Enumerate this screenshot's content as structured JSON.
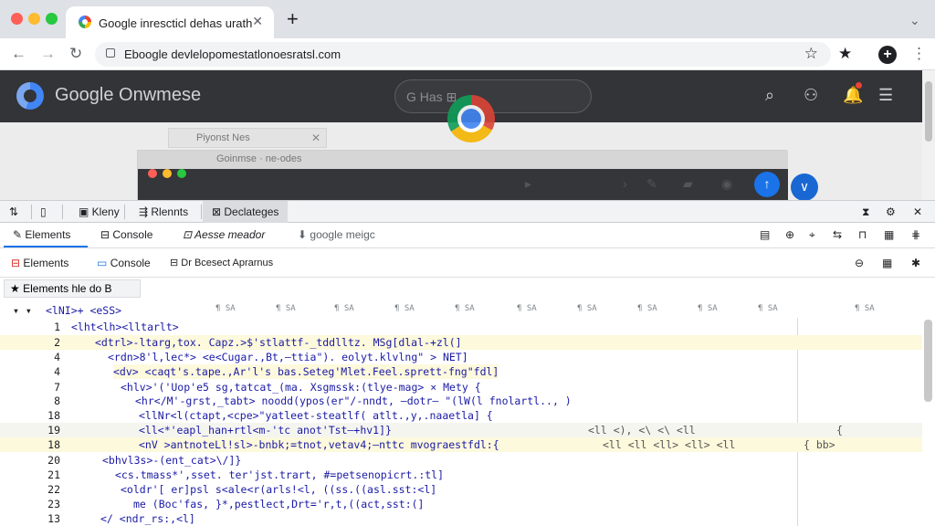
{
  "browser": {
    "tab_title": "Google inrescticl dehas urath",
    "tab_close": "✕",
    "new_tab": "+",
    "url": "Eboogle devlelopomestatlonoesratsl.com",
    "colors": {
      "tabstrip": "#dee1e6",
      "close": "#ff5f57",
      "minimize": "#febc2e",
      "maximize": "#28c840"
    }
  },
  "page": {
    "header_title": "Google Onwmese",
    "search_text": "G Has ⊞",
    "ghost_window_title": "Piyonst  Nes",
    "ghost_bar_title": "Goinmse ·  ne-odes"
  },
  "devtools": {
    "top_tabs": [
      "Kleny",
      "Rlennts",
      "Declateges"
    ],
    "second_tabs": [
      "Elements",
      "Console",
      "Aesse meador",
      "google meigc"
    ],
    "third_tabs": [
      "Elements",
      "Console",
      "Dr Bcesect Aprarnus"
    ],
    "breadcrumb": "Elements hle do  B",
    "column_marker": "¶ SA",
    "lines": [
      {
        "num": "",
        "code": "<lNI>+ <eSS>"
      },
      {
        "num": "1",
        "code": "<lht<lh><lltarlt>"
      },
      {
        "num": "2",
        "code": "<dtrl>-ltarg,tox. Capz.>$'stlattf-_tddlltz. MSg[dlal-+zl(]"
      },
      {
        "num": "4",
        "code": "<rdn>8'l,lec*> <e<Cugar.,Bt,—ttia\"). eolyt.klvlng\" > NET]"
      },
      {
        "num": "4",
        "code": "<dv> <caqt's.tape.,Ar'l's  bas.Seteg'Mlet.Feel.sprett-fng\"fdl]"
      },
      {
        "num": "7",
        "code": "<hlv>'('Uop'e5 sg,tatcat_(ma.  Xsgmssk:(tlye-mag> × Mety  {"
      },
      {
        "num": "8",
        "code": "<hr</M'-grst,_tabt> noodd(ypos(er\"/-nndt, —dotr— \"(lW(l     fnolartl.., )"
      },
      {
        "num": "18",
        "code": "<llNr<l(ctapt,<cpe>\"yatleet-steatlf(  atlt.,y,.naaetla]  {"
      },
      {
        "num": "19",
        "code": "<ll<*'eapl_han+rtl<m-'tc anot'Tst—+hv1]}"
      },
      {
        "num": "18",
        "code": "<nV >antnoteLl!sl>-bnbk;=tnot,vetav4;—nttc mvograestfdl:{"
      },
      {
        "num": "20",
        "code": "<bhvl3s>-(ent_cat>\\/]}"
      },
      {
        "num": "21",
        "code": "<cs.tmass*',sset. ter'jst.trart, #=petsenopicrt.:tl]"
      },
      {
        "num": "22",
        "code": "<oldr'[ er]psl s<ale<r(arls!<l, ((ss.((asl.sst:<l]"
      },
      {
        "num": "23",
        "code": "me (Boc'fas, }*,pestlect,Drt='r,t,((act,sst:(]"
      },
      {
        "num": "13",
        "code": "</ <ndr_rs:,<l]"
      }
    ],
    "tails": {
      "r2": "<ll     <),     <\\     <\\     <ll",
      "r3": "<ll     <ll     <ll>    <ll>    <ll",
      "r3_end": "{ bb>"
    }
  }
}
